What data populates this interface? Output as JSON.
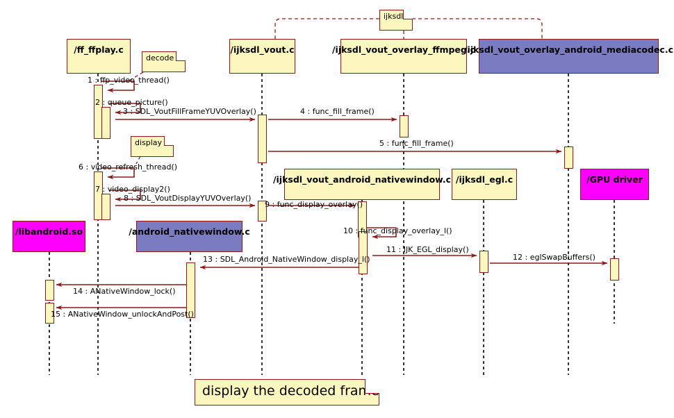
{
  "diagram": {
    "type": "uml-sequence-diagram",
    "title_note": "display the decoded frame",
    "colors": {
      "note_fill": "#fbf7bf",
      "border": "#8b1a1a",
      "arrow": "#8b1a1a",
      "purple_participant": "#7b7bc2",
      "magenta_participant": "#ff00ff",
      "lifeline": "#000000"
    }
  },
  "participants": [
    {
      "id": "libandroid",
      "label": "/libandroid.so",
      "color": "magenta"
    },
    {
      "id": "ffplay",
      "label": "/ff_ffplay.c",
      "color": "yellow"
    },
    {
      "id": "androidnw",
      "label": "/android_nativewindow.c",
      "color": "purple"
    },
    {
      "id": "vout",
      "label": "/ijksdl_vout.c",
      "color": "yellow"
    },
    {
      "id": "vout_android",
      "label": "/ijksdl_vout_android_nativewindow.c",
      "color": "yellow"
    },
    {
      "id": "ffmpeg",
      "label": "/ijksdl_vout_overlay_ffmpeg.c",
      "color": "yellow"
    },
    {
      "id": "egl",
      "label": "/ijksdl_egl.c",
      "color": "yellow"
    },
    {
      "id": "mediacodec",
      "label": "/ijksdl_vout_overlay_android_mediacodec.c",
      "color": "purple"
    },
    {
      "id": "gpu",
      "label": "/GPU driver",
      "color": "magenta"
    }
  ],
  "notes": [
    {
      "id": "note-ijksdl",
      "text": "ijksdl"
    },
    {
      "id": "note-decode",
      "text": "decode"
    },
    {
      "id": "note-display",
      "text": "display"
    }
  ],
  "messages": [
    {
      "num": "1",
      "label": "1 : ffp_video_thread()",
      "from": "ffplay",
      "to": "ffplay",
      "kind": "self"
    },
    {
      "num": "2",
      "label": "2 : queue_picture()",
      "from": "ffplay",
      "to": "ffplay",
      "kind": "self"
    },
    {
      "num": "3",
      "label": "3 : SDL_VoutFillFrameYUVOverlay()",
      "from": "ffplay",
      "to": "vout",
      "kind": "call"
    },
    {
      "num": "4",
      "label": "4 : func_fill_frame()",
      "from": "vout",
      "to": "ffmpeg",
      "kind": "call"
    },
    {
      "num": "5",
      "label": "5 : func_fill_frame()",
      "from": "vout",
      "to": "mediacodec",
      "kind": "call"
    },
    {
      "num": "6",
      "label": "6 : video_refresh_thread()",
      "from": "ffplay",
      "to": "ffplay",
      "kind": "self"
    },
    {
      "num": "7",
      "label": "7 : video_display2()",
      "from": "ffplay",
      "to": "ffplay",
      "kind": "self"
    },
    {
      "num": "8",
      "label": "8 : SDL_VoutDisplayYUVOverlay()",
      "from": "ffplay",
      "to": "vout",
      "kind": "call"
    },
    {
      "num": "9",
      "label": "9 : func_display_overlay()",
      "from": "vout",
      "to": "vout_android",
      "kind": "call"
    },
    {
      "num": "10",
      "label": "10 : func_display_overlay_l()",
      "from": "vout_android",
      "to": "vout_android",
      "kind": "self"
    },
    {
      "num": "11",
      "label": "11 : IJK_EGL_display()",
      "from": "vout_android",
      "to": "egl",
      "kind": "call"
    },
    {
      "num": "12",
      "label": "12 : eglSwapBuffers()",
      "from": "egl",
      "to": "gpu",
      "kind": "call"
    },
    {
      "num": "13",
      "label": "13 : SDL_Android_NativeWindow_display_l()",
      "from": "vout_android",
      "to": "androidnw",
      "kind": "call-left"
    },
    {
      "num": "14",
      "label": "14 : ANativeWindow_lock()",
      "from": "androidnw",
      "to": "libandroid",
      "kind": "call-left"
    },
    {
      "num": "15",
      "label": "15 : ANativeWindow_unlockAndPost()",
      "from": "androidnw",
      "to": "libandroid",
      "kind": "call-left"
    }
  ]
}
